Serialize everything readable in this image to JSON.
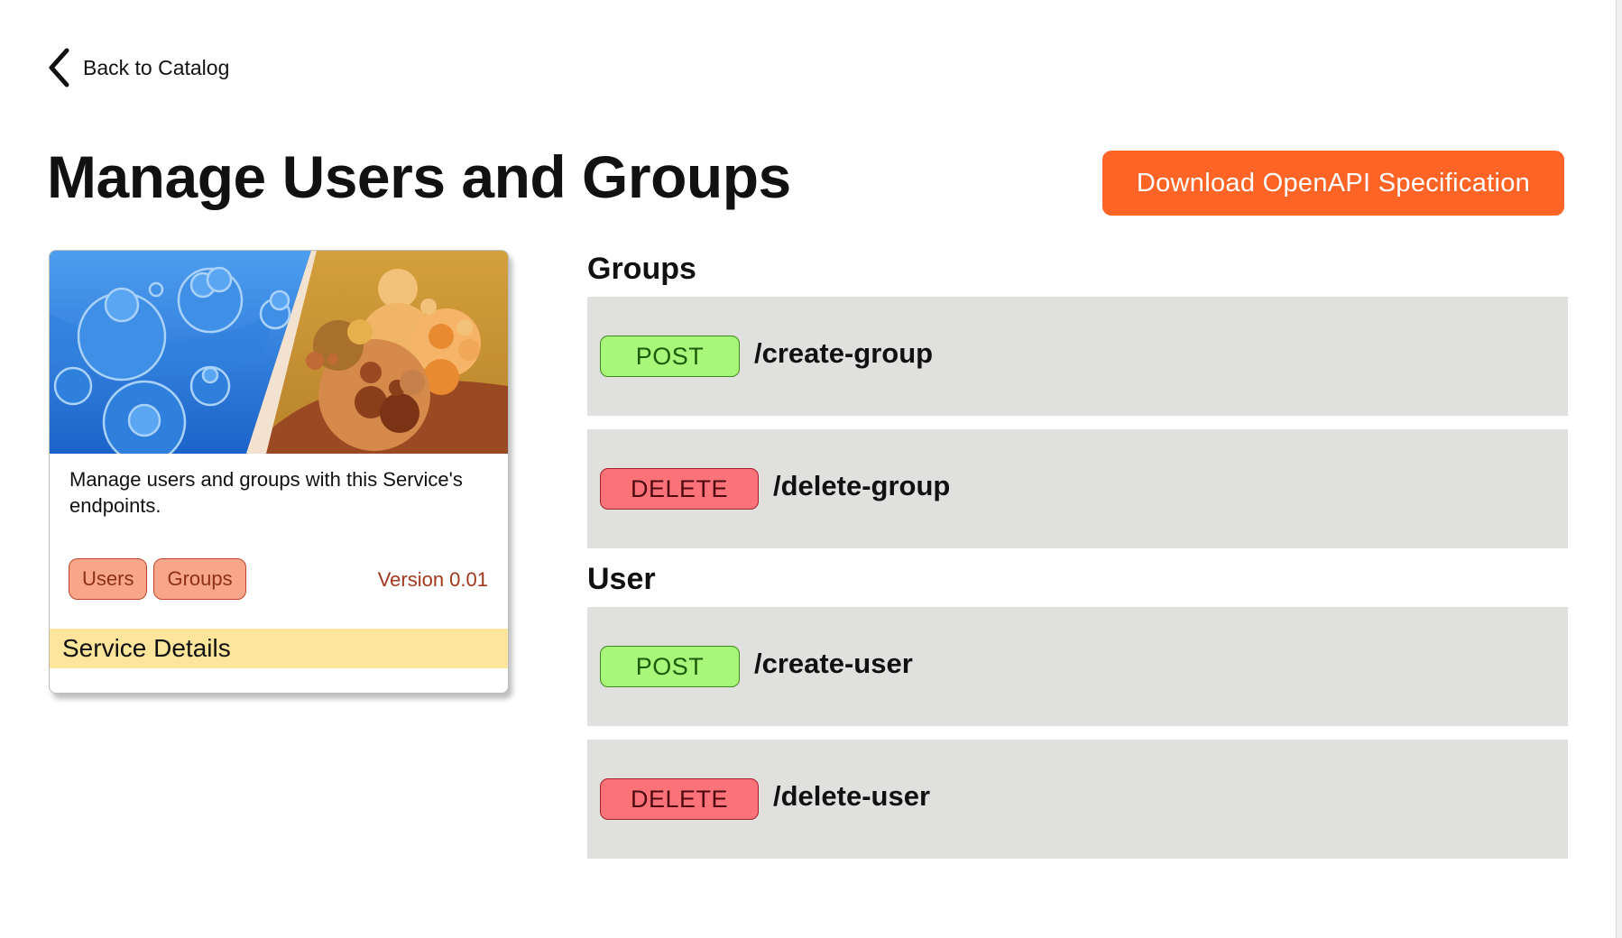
{
  "nav": {
    "back_label": "Back to Catalog"
  },
  "header": {
    "title": "Manage Users and Groups",
    "download_label": "Download OpenAPI Specification"
  },
  "card": {
    "description": "Manage users and groups with this Service's endpoints.",
    "tags": [
      "Users",
      "Groups"
    ],
    "version": "Version 0.01",
    "details_label": "Service Details"
  },
  "sections": [
    {
      "title": "Groups",
      "endpoints": [
        {
          "method": "POST",
          "path": "/create-group"
        },
        {
          "method": "DELETE",
          "path": "/delete-group"
        }
      ]
    },
    {
      "title": "User",
      "endpoints": [
        {
          "method": "POST",
          "path": "/create-user"
        },
        {
          "method": "DELETE",
          "path": "/delete-user"
        }
      ]
    }
  ],
  "colors": {
    "accent": "#ff6427",
    "post_badge": "#a8f77a",
    "delete_badge": "#fb7379",
    "tag_fill": "#f7a68a",
    "details_bar": "#fde59c",
    "endpoint_row": "#e0e0de"
  },
  "icons": {
    "back": "chevron-left-icon"
  }
}
